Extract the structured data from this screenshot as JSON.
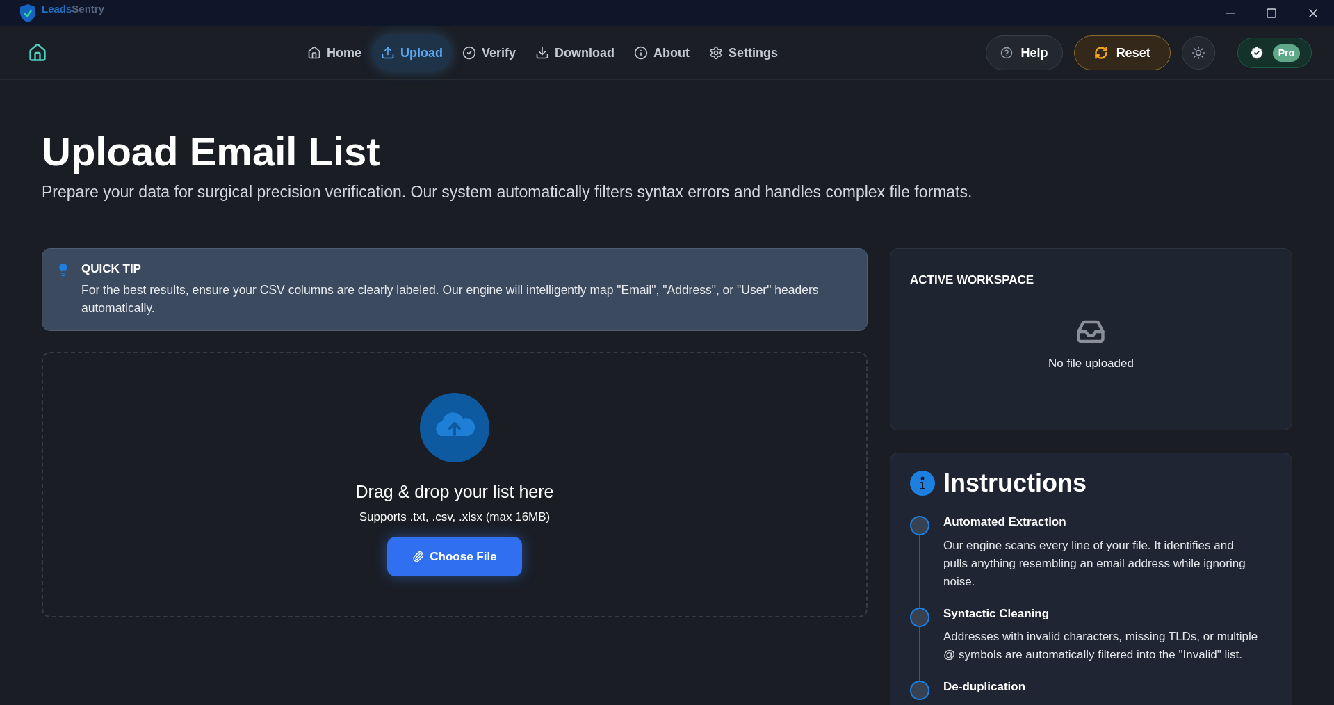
{
  "window": {
    "title_primary": "Leads",
    "title_secondary": "Sentry"
  },
  "nav": {
    "items": [
      {
        "label": "Home",
        "selected": false
      },
      {
        "label": "Upload",
        "selected": true
      },
      {
        "label": "Verify",
        "selected": false
      },
      {
        "label": "Download",
        "selected": false
      },
      {
        "label": "About",
        "selected": false
      },
      {
        "label": "Settings",
        "selected": false
      }
    ],
    "help": "Help",
    "reset": "Reset",
    "plan_badge": "Pro"
  },
  "page": {
    "title": "Upload Email List",
    "subtitle": "Prepare your data for surgical precision verification. Our system automatically filters syntax errors and handles complex file formats."
  },
  "tip": {
    "heading": "QUICK TIP",
    "text": "For the best results, ensure your CSV columns are clearly labeled. Our engine will intelligently map \"Email\", \"Address\", or \"User\" headers automatically."
  },
  "dropzone": {
    "heading": "Drag & drop your list here",
    "hint": "Supports .txt, .csv, .xlsx (max 16MB)",
    "button": "Choose File"
  },
  "workspace": {
    "heading": "ACTIVE WORKSPACE",
    "empty_text": "No file uploaded"
  },
  "instructions": {
    "title": "Instructions",
    "steps": [
      {
        "title": "Automated Extraction",
        "text": "Our engine scans every line of your file. It identifies and pulls anything resembling an email address while ignoring noise."
      },
      {
        "title": "Syntactic Cleaning",
        "text": "Addresses with invalid characters, missing TLDs, or multiple @ symbols are automatically filtered into the \"Invalid\" list."
      },
      {
        "title": "De-duplication"
      }
    ]
  }
}
